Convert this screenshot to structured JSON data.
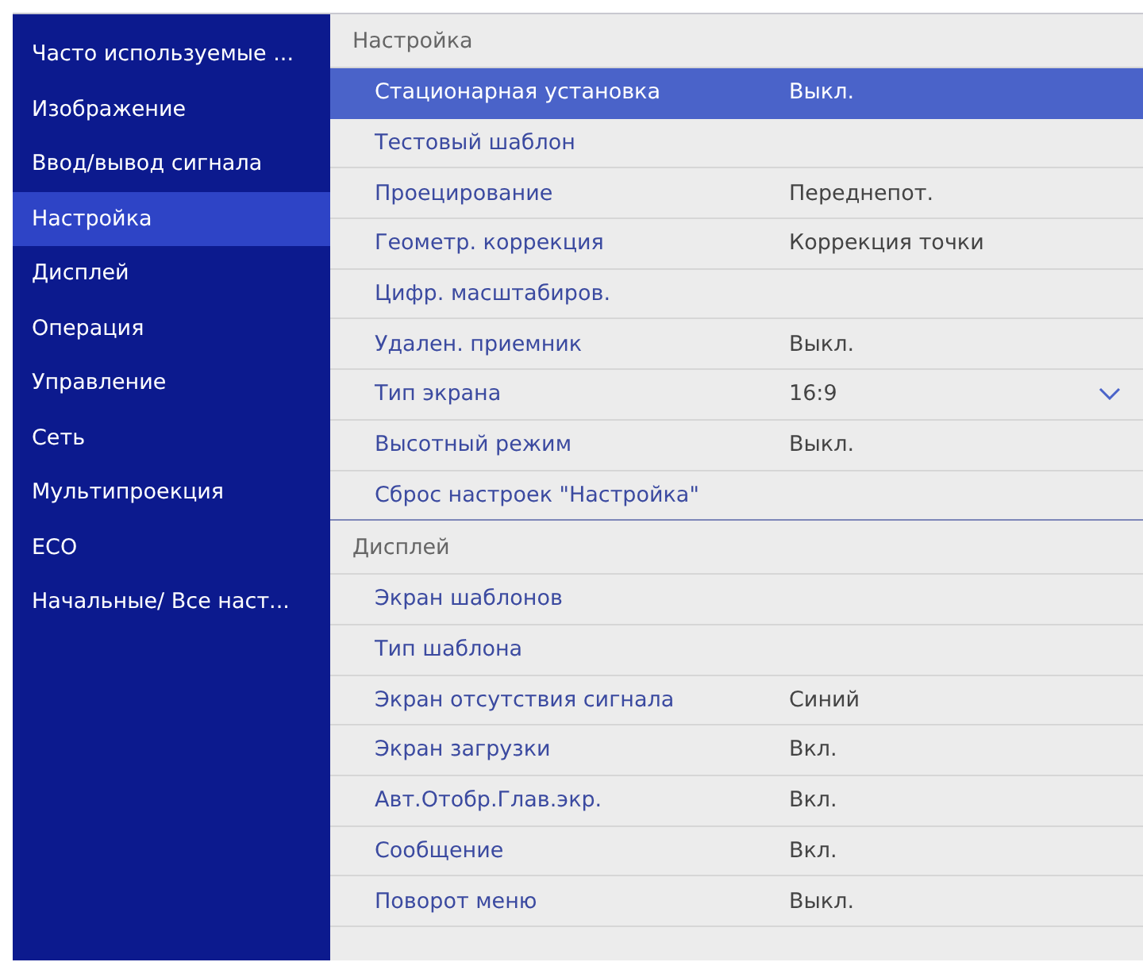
{
  "sidebar": {
    "items": [
      {
        "label": "Часто используемые ...",
        "selected": false
      },
      {
        "label": "Изображение",
        "selected": false
      },
      {
        "label": "Ввод/вывод сигнала",
        "selected": false
      },
      {
        "label": "Настройка",
        "selected": true
      },
      {
        "label": "Дисплей",
        "selected": false
      },
      {
        "label": "Операция",
        "selected": false
      },
      {
        "label": "Управление",
        "selected": false
      },
      {
        "label": "Сеть",
        "selected": false
      },
      {
        "label": "Мультипроекция",
        "selected": false
      },
      {
        "label": "ECO",
        "selected": false
      },
      {
        "label": "Начальные/ Все наст...",
        "selected": false
      }
    ]
  },
  "sections": [
    {
      "title": "Настройка",
      "items": [
        {
          "kind": "plain",
          "label": "Стационарная установка",
          "value": "Выкл.",
          "selected": true
        },
        {
          "kind": "plain",
          "label": "Тестовый шаблон",
          "selected": false
        },
        {
          "kind": "plain",
          "label": "Проецирование",
          "value": "Переднепот.",
          "selected": false
        },
        {
          "kind": "plain",
          "label": "Геометр. коррекция",
          "value": "Коррекция точки",
          "selected": false
        },
        {
          "kind": "plain",
          "label": "Цифр. масштабиров.",
          "selected": false
        },
        {
          "kind": "plain",
          "label": "Удален. приемник",
          "value": "Выкл.",
          "selected": false
        },
        {
          "kind": "dropdown",
          "label": "Тип экрана",
          "value": "16:9",
          "selected": false
        },
        {
          "kind": "plain",
          "label": "Высотный режим",
          "value": "Выкл.",
          "selected": false
        },
        {
          "kind": "plain",
          "label": "Сброс настроек \"Настройка\"",
          "selected": false
        }
      ]
    },
    {
      "title": "Дисплей",
      "items": [
        {
          "kind": "plain",
          "label": "Экран шаблонов",
          "selected": false
        },
        {
          "kind": "plain",
          "label": "Тип шаблона",
          "selected": false
        },
        {
          "kind": "plain",
          "label": "Экран отсутствия сигнала",
          "value": "Синий",
          "selected": false
        },
        {
          "kind": "plain",
          "label": "Экран загрузки",
          "value": "Вкл.",
          "selected": false
        },
        {
          "kind": "plain",
          "label": "Авт.Отобр.Глав.экр.",
          "value": "Вкл.",
          "selected": false
        },
        {
          "kind": "plain",
          "label": "Сообщение",
          "value": "Вкл.",
          "selected": false
        },
        {
          "kind": "plain",
          "label": "Поворот меню",
          "value": "Выкл.",
          "selected": false
        }
      ]
    }
  ]
}
